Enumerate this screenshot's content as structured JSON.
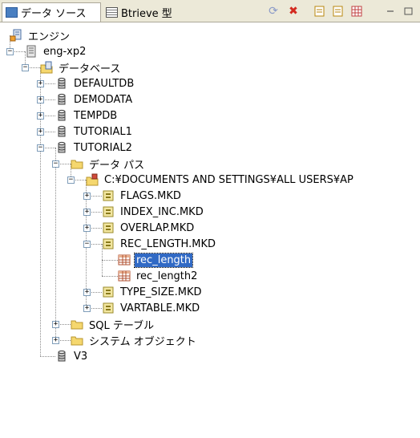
{
  "tabs": [
    {
      "label": "データ ソース",
      "icon": "data-source-icon"
    },
    {
      "label": "Btrieve 型",
      "icon": "btrieve-icon"
    }
  ],
  "toolbar_icons": [
    "refresh-icon",
    "delete-icon",
    "properties-icon",
    "properties2-icon",
    "grid-icon",
    "minimize-icon",
    "maximize-icon"
  ],
  "tree": [
    {
      "label": "エンジン",
      "icon": "engine-icon"
    },
    {
      "label": "eng-xp2",
      "icon": "server-icon"
    },
    {
      "label": "データベース",
      "icon": "database-folder-icon"
    },
    {
      "label": "DEFAULTDB",
      "icon": "database-icon"
    },
    {
      "label": "DEMODATA",
      "icon": "database-icon"
    },
    {
      "label": "TEMPDB",
      "icon": "database-icon"
    },
    {
      "label": "TUTORIAL1",
      "icon": "database-icon"
    },
    {
      "label": "TUTORIAL2",
      "icon": "database-icon"
    },
    {
      "label": "データ パス",
      "icon": "folder-icon"
    },
    {
      "label": "C:¥DOCUMENTS AND SETTINGS¥ALL USERS¥AP",
      "icon": "path-folder-icon"
    },
    {
      "label": "FLAGS.MKD",
      "icon": "file-icon"
    },
    {
      "label": "INDEX_INC.MKD",
      "icon": "file-icon"
    },
    {
      "label": "OVERLAP.MKD",
      "icon": "file-icon"
    },
    {
      "label": "REC_LENGTH.MKD",
      "icon": "file-icon"
    },
    {
      "label": "rec_length",
      "icon": "table-icon",
      "selected": true
    },
    {
      "label": "rec_length2",
      "icon": "table-icon"
    },
    {
      "label": "TYPE_SIZE.MKD",
      "icon": "file-icon"
    },
    {
      "label": "VARTABLE.MKD",
      "icon": "file-icon"
    },
    {
      "label": "SQL テーブル",
      "icon": "folder-icon"
    },
    {
      "label": "システム オブジェクト",
      "icon": "folder-icon"
    },
    {
      "label": "V3",
      "icon": "database-icon"
    }
  ],
  "colors": {
    "selection": "#316ac5",
    "folder": "#f5d76e",
    "toolbar": "#ece9d8"
  }
}
